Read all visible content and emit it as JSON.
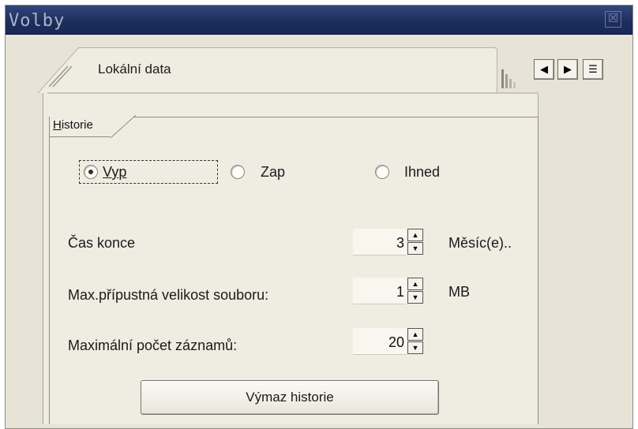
{
  "window": {
    "title": "Volby",
    "close_symbol": "☒"
  },
  "tabs": {
    "active_label": "Lokální data",
    "nav_prev": "◀",
    "nav_next": "▶",
    "nav_list": "☰"
  },
  "group": {
    "title_first": "H",
    "title_rest": "istorie"
  },
  "history_mode": {
    "options": [
      "Vyp",
      "Zap",
      "Ihned"
    ],
    "selected": "Vyp"
  },
  "fields": [
    {
      "label": "Čas konce",
      "value": "3",
      "unit": "Měsíc(e).."
    },
    {
      "label": "Max.přípustná velikost souboru:",
      "value": "1",
      "unit": "MB"
    },
    {
      "label": "Maximální počet záznamů:",
      "value": "20",
      "unit": ""
    }
  ],
  "spin": {
    "up": "▲",
    "down": "▼"
  },
  "actions": {
    "clear_history": "Výmaz historie"
  },
  "colors": {
    "titlebar": "#1c2d5c",
    "panel": "#efece2",
    "window_bg": "#e7e3d6"
  }
}
